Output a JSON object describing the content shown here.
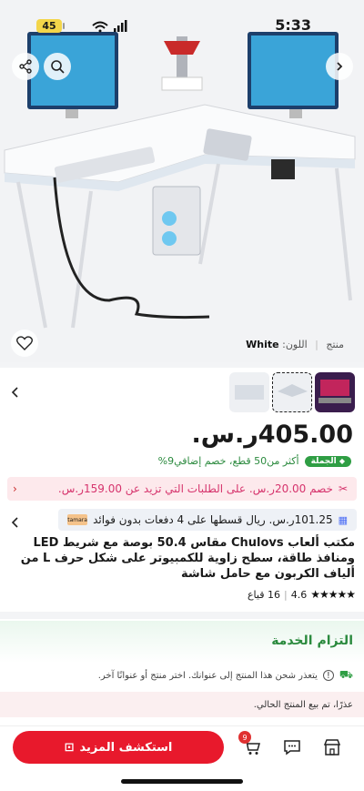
{
  "status": {
    "battery": "45",
    "time": "5:33"
  },
  "hero": {
    "product_label": "منتج",
    "color_label": "اللون:",
    "color_value": "White"
  },
  "price": "405.00ر.س.",
  "wholesale": {
    "badge": "الجملة",
    "text": "أكثر من50 قطع، خصم إضافي9%"
  },
  "promo": {
    "text": "خصم 20.00ر.س. على الطلبات التي تزيد عن 159.00ر.س."
  },
  "installments": {
    "text": "101.25ر.س. ريال قسطها على 4 دفعات بدون فوائد",
    "provider": "tamara"
  },
  "title": "مكتب ألعاب Chulovs مقاس 50.4 بوصة مع شريط LED ومنافذ طاقة، سطح زاوية للكمبيوتر على شكل حرف L من ألياف الكربون مع حامل شاشة",
  "rating": {
    "score": "4.6",
    "reviews": "16 قياع"
  },
  "service": {
    "title": "التزام الخدمة"
  },
  "shipping_note": "يتعذر شحن هذا المنتج إلى عنوانك. اختر منتج أو عنوانًا آخر.",
  "sold_note": "عذرًا، تم بيع المنتج الحالي.",
  "bottom": {
    "cta_label": "استكشف المزيد",
    "cart_count": "9"
  },
  "accent": "#e8192c"
}
